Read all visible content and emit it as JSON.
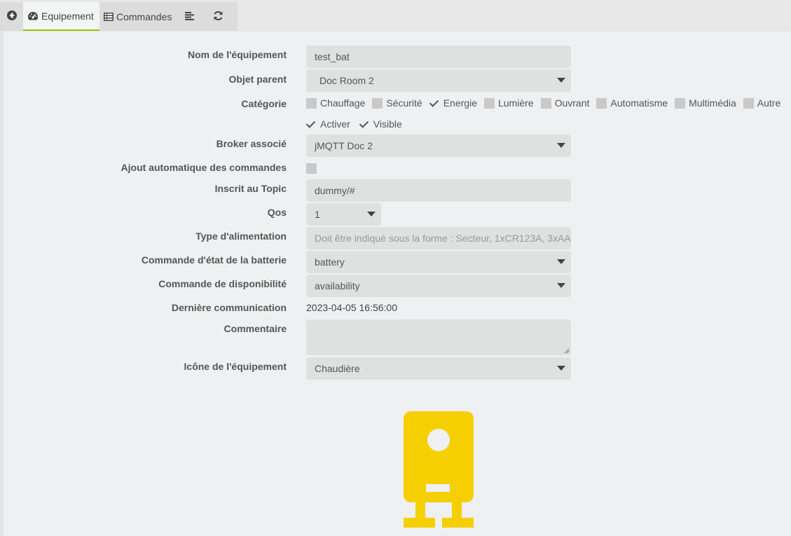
{
  "tabs": {
    "back_icon": "circle-arrow-left-icon",
    "equipement": "Equipement",
    "commandes": "Commandes",
    "list_icon": "align-left-icon",
    "refresh_icon": "refresh-icon"
  },
  "form": {
    "nom": {
      "label": "Nom de l'équipement",
      "value": "test_bat"
    },
    "parent": {
      "label": "Objet parent",
      "value": "Doc Room 2"
    },
    "categorie": {
      "label": "Catégorie",
      "items": [
        {
          "label": "Chauffage",
          "checked": false
        },
        {
          "label": "Sécurité",
          "checked": false
        },
        {
          "label": "Energie",
          "checked": true
        },
        {
          "label": "Lumière",
          "checked": false
        },
        {
          "label": "Ouvrant",
          "checked": false
        },
        {
          "label": "Automatisme",
          "checked": false
        },
        {
          "label": "Multimédia",
          "checked": false
        },
        {
          "label": "Autre",
          "checked": false
        }
      ]
    },
    "options": [
      {
        "label": "Activer",
        "checked": true
      },
      {
        "label": "Visible",
        "checked": true
      }
    ],
    "broker": {
      "label": "Broker associé",
      "value": "jMQTT Doc 2"
    },
    "ajout_auto": {
      "label": "Ajout automatique des commandes",
      "checked": false
    },
    "topic": {
      "label": "Inscrit au Topic",
      "value": "dummy/#"
    },
    "qos": {
      "label": "Qos",
      "value": "1"
    },
    "alimentation": {
      "label": "Type d'alimentation",
      "placeholder": "Doit être indiqué sous la forme : Secteur, 1xCR123A, 3xAA"
    },
    "batterie": {
      "label": "Commande d'état de la batterie",
      "value": "battery"
    },
    "dispo": {
      "label": "Commande de disponibilité",
      "value": "availability"
    },
    "derniere": {
      "label": "Dernière communication",
      "value": "2023-04-05 16:56:00"
    },
    "commentaire": {
      "label": "Commentaire",
      "value": ""
    },
    "icone": {
      "label": "Icône de l'équipement",
      "value": "Chaudière"
    }
  },
  "colors": {
    "accent": "#94ca02",
    "device_icon": "#f5cf00"
  },
  "device_icon": "boiler-icon"
}
